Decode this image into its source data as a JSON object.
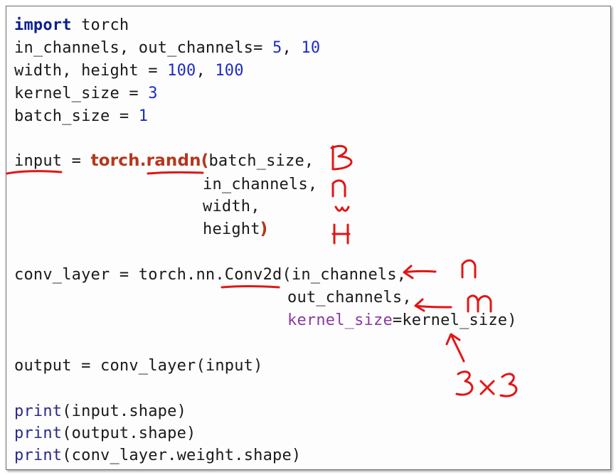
{
  "code": {
    "l1": {
      "kw": "import",
      "rest": " torch"
    },
    "l2": {
      "text": "in_channels, out_channels= ",
      "n1": "5",
      "sep": ", ",
      "n2": "10"
    },
    "l3": {
      "text": "width, height = ",
      "n1": "100",
      "sep": ", ",
      "n2": "100"
    },
    "l4": {
      "text": "kernel_size = ",
      "n": "3"
    },
    "l5": {
      "text": "batch_size = ",
      "n": "1"
    },
    "l6": {
      "lhs": "input = ",
      "fn": "torch.randn(",
      "arg": "batch_size,"
    },
    "l7": {
      "arg": "in_channels,"
    },
    "l8": {
      "arg": "width,"
    },
    "l9": {
      "arg": "height",
      "close": ")"
    },
    "l10": {
      "text": "conv_layer = torch.nn.Conv2d(in_channels,"
    },
    "l11": {
      "arg": "out_channels,"
    },
    "l12": {
      "param": "kernel_size",
      "rest": "=kernel_size)"
    },
    "l13": {
      "text": "output = conv_layer(input)"
    },
    "l14": {
      "fn": "print",
      "rest": "(input.shape)"
    },
    "l15": {
      "fn": "print",
      "rest": "(output.shape)"
    },
    "l16": {
      "fn": "print",
      "rest": "(conv_layer.weight.shape)"
    }
  }
}
